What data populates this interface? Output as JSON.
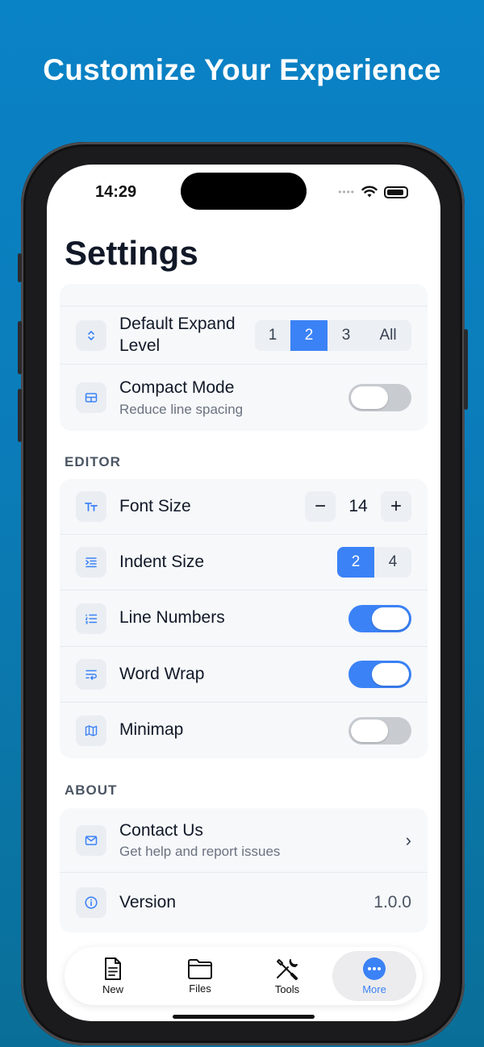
{
  "headline": "Customize Your Experience",
  "status": {
    "time": "14:29"
  },
  "page": {
    "title": "Settings"
  },
  "sections": {
    "general": {
      "expand": {
        "label_line1": "Default Expand",
        "label_line2": "Level",
        "options": [
          "1",
          "2",
          "3",
          "All"
        ],
        "selected": "2",
        "icon": "chevron-up-down-icon"
      },
      "compact": {
        "label": "Compact Mode",
        "subtitle": "Reduce line spacing",
        "enabled": false,
        "icon": "layout-icon"
      }
    },
    "editor": {
      "header": "EDITOR",
      "font_size": {
        "label": "Font Size",
        "value": "14",
        "minus": "−",
        "plus": "+",
        "icon": "text-size-icon"
      },
      "indent": {
        "label": "Indent Size",
        "options": [
          "2",
          "4"
        ],
        "selected": "2",
        "icon": "indent-icon"
      },
      "line_numbers": {
        "label": "Line Numbers",
        "enabled": true,
        "icon": "numbered-list-icon"
      },
      "word_wrap": {
        "label": "Word Wrap",
        "enabled": true,
        "icon": "wrap-icon"
      },
      "minimap": {
        "label": "Minimap",
        "enabled": false,
        "icon": "map-icon"
      }
    },
    "about": {
      "header": "ABOUT",
      "contact": {
        "label": "Contact Us",
        "subtitle": "Get help and report issues",
        "chevron": "›",
        "icon": "mail-icon"
      },
      "version": {
        "label": "Version",
        "value": "1.0.0",
        "icon": "info-icon"
      }
    }
  },
  "tabbar": {
    "items": [
      {
        "label": "New",
        "icon": "document-icon"
      },
      {
        "label": "Files",
        "icon": "folder-icon"
      },
      {
        "label": "Tools",
        "icon": "tools-icon"
      },
      {
        "label": "More",
        "icon": "more-icon",
        "active": true
      }
    ]
  },
  "colors": {
    "accent": "#3b82f6",
    "background": "#0a7dbb"
  }
}
